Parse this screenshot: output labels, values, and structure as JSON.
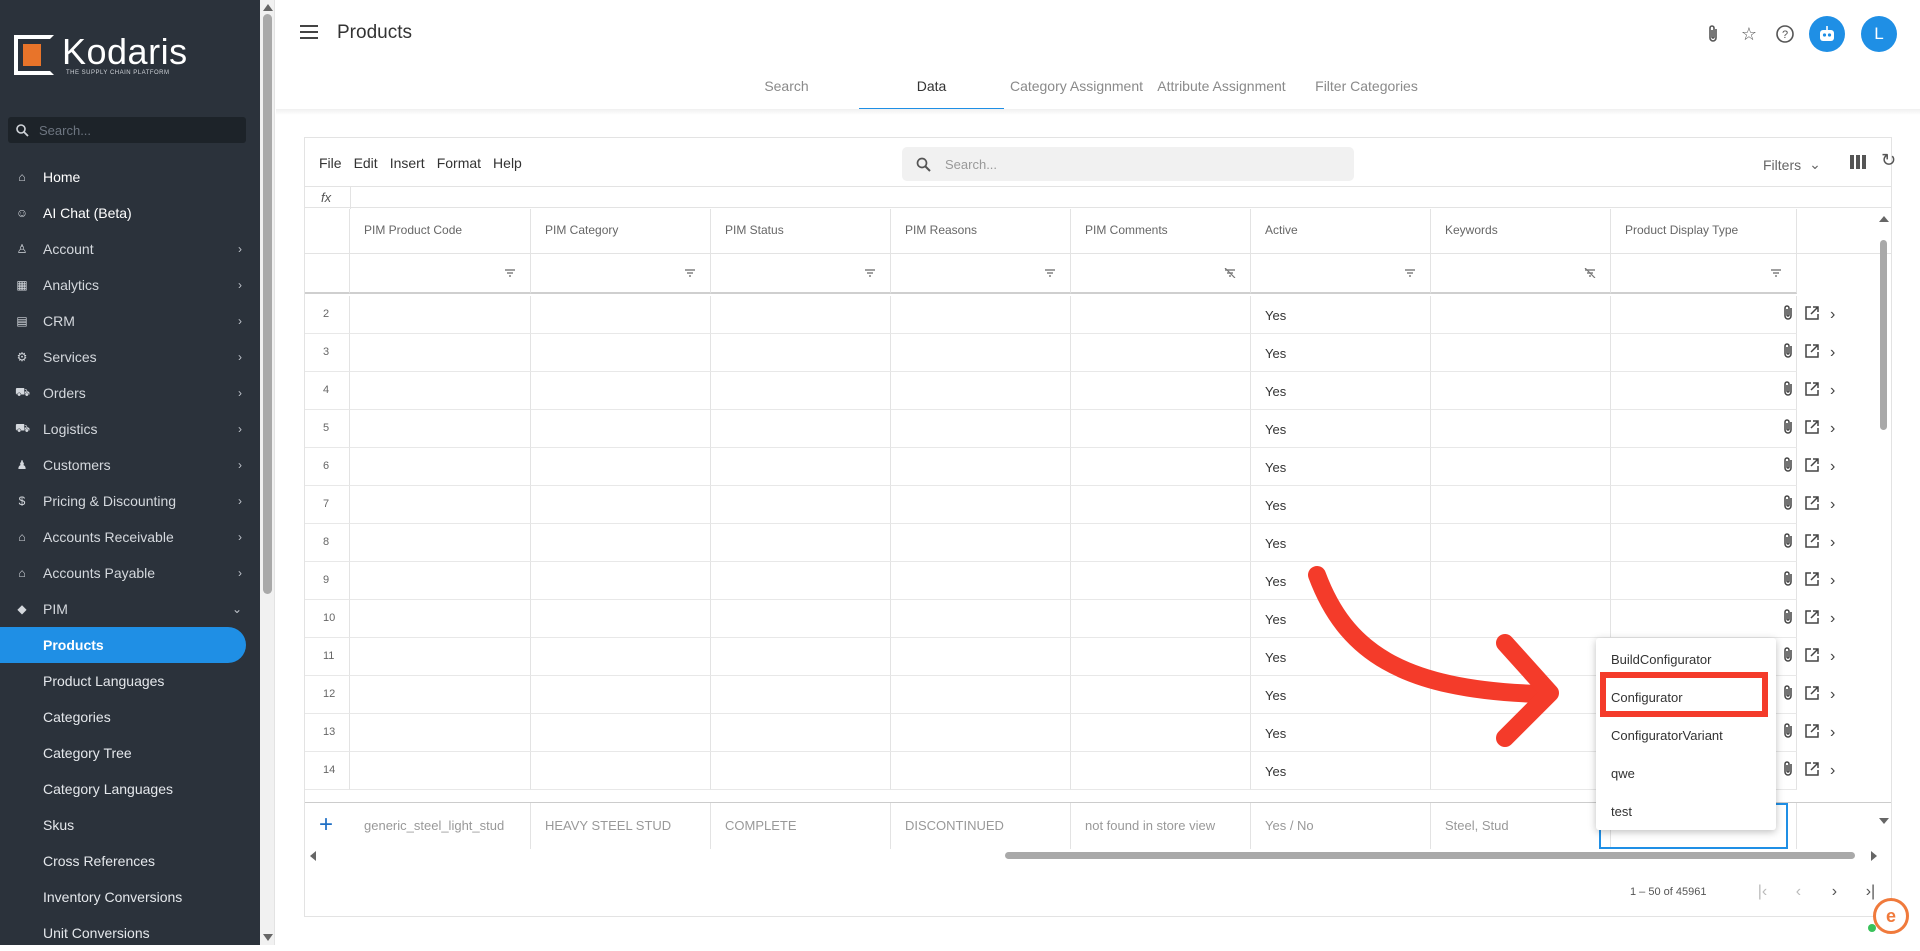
{
  "sidebar": {
    "logo_name": "Kodaris",
    "logo_tagline": "THE SUPPLY CHAIN PLATFORM",
    "search_placeholder": "Search...",
    "nav": [
      {
        "label": "Home",
        "icon": "home-icon",
        "glyph": "⌂",
        "chevron": false
      },
      {
        "label": "AI Chat (Beta)",
        "icon": "robot-icon",
        "glyph": "☺",
        "chevron": false
      },
      {
        "label": "Account",
        "icon": "person-icon",
        "glyph": "♙",
        "chevron": true
      },
      {
        "label": "Analytics",
        "icon": "analytics-icon",
        "glyph": "▦",
        "chevron": true
      },
      {
        "label": "CRM",
        "icon": "crm-icon",
        "glyph": "▤",
        "chevron": true
      },
      {
        "label": "Services",
        "icon": "gears-icon",
        "glyph": "⚙",
        "chevron": true
      },
      {
        "label": "Orders",
        "icon": "truck-icon",
        "glyph": "⛟",
        "chevron": true
      },
      {
        "label": "Logistics",
        "icon": "shipping-icon",
        "glyph": "⛟",
        "chevron": true
      },
      {
        "label": "Customers",
        "icon": "group-icon",
        "glyph": "♟",
        "chevron": true
      },
      {
        "label": "Pricing & Discounting",
        "icon": "dollar-icon",
        "glyph": "$",
        "chevron": true
      },
      {
        "label": "Accounts Receivable",
        "icon": "bank-icon",
        "glyph": "⌂",
        "chevron": true
      },
      {
        "label": "Accounts Payable",
        "icon": "bank-icon",
        "glyph": "⌂",
        "chevron": true
      },
      {
        "label": "PIM",
        "icon": "tag-icon",
        "glyph": "◆",
        "chevron": true,
        "expanded": true
      }
    ],
    "pim_items": [
      "Products",
      "Product Languages",
      "Categories",
      "Category Tree",
      "Category Languages",
      "Skus",
      "Cross References",
      "Inventory Conversions",
      "Unit Conversions"
    ],
    "active_item": "Products"
  },
  "header": {
    "title": "Products",
    "avatar_letter": "L"
  },
  "tabs": [
    "Search",
    "Data",
    "Category Assignment",
    "Attribute Assignment",
    "Filter Categories"
  ],
  "active_tab": "Data",
  "toolbar": {
    "menus": [
      "File",
      "Edit",
      "Insert",
      "Format",
      "Help"
    ],
    "search_placeholder": "Search...",
    "filters_label": "Filters",
    "fx_label": "fx"
  },
  "grid": {
    "columns": [
      "PIM Product Code",
      "PIM Category",
      "PIM Status",
      "PIM Reasons",
      "PIM Comments",
      "Active",
      "Keywords",
      "Product Display Type"
    ],
    "filter_icons": [
      "filter",
      "filter",
      "filter",
      "filter",
      "filter-off",
      "filter",
      "filter-off",
      "filter"
    ],
    "rows": [
      {
        "num": "2",
        "active": "Yes"
      },
      {
        "num": "3",
        "active": "Yes"
      },
      {
        "num": "4",
        "active": "Yes"
      },
      {
        "num": "5",
        "active": "Yes"
      },
      {
        "num": "6",
        "active": "Yes"
      },
      {
        "num": "7",
        "active": "Yes"
      },
      {
        "num": "8",
        "active": "Yes"
      },
      {
        "num": "9",
        "active": "Yes"
      },
      {
        "num": "10",
        "active": "Yes"
      },
      {
        "num": "11",
        "active": "Yes"
      },
      {
        "num": "12",
        "active": "Yes"
      },
      {
        "num": "13",
        "active": "Yes"
      },
      {
        "num": "14",
        "active": "Yes"
      }
    ],
    "new_row": {
      "code": "generic_steel_light_stud",
      "category": "HEAVY STEEL STUD",
      "status": "COMPLETE",
      "reasons": "DISCONTINUED",
      "comments": "not found in store view",
      "active": "Yes / No",
      "keywords": "Steel, Stud",
      "display_type": ""
    },
    "pagination": "1 – 50 of 45961"
  },
  "dropdown": {
    "options": [
      "BuildConfigurator",
      "Configurator",
      "ConfiguratorVariant",
      "qwe",
      "test"
    ],
    "highlighted": "Configurator"
  },
  "colors": {
    "accent": "#1f8fe5",
    "sidebar_bg": "#2b323b",
    "annotation_red": "#f43b2a",
    "brand_orange": "#e8742a"
  }
}
